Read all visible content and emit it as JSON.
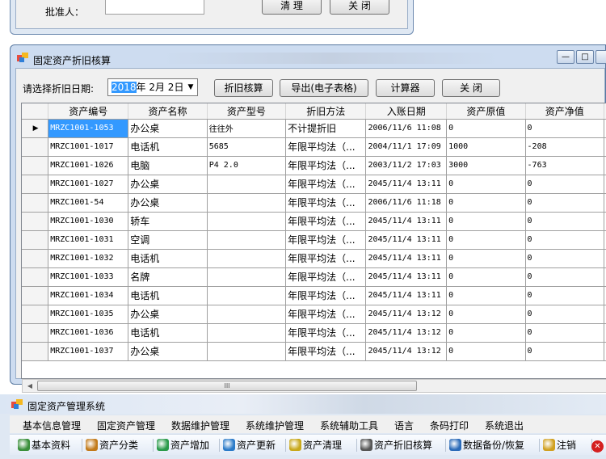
{
  "top_window": {
    "approver_label": "批准人：",
    "clear_button": "清 理",
    "close_button": "关 闭"
  },
  "dialog": {
    "title": "固定资产折旧核算",
    "date_label": "请选择折旧日期:",
    "date_value_year": "2018",
    "date_value_rest": "年 2月 2日",
    "buttons": {
      "calc": "折旧核算",
      "export": "导出(电子表格)",
      "calculator": "计算器",
      "close": "关 闭"
    },
    "columns": [
      "资产编号",
      "资产名称",
      "资产型号",
      "折旧方法",
      "入账日期",
      "资产原值",
      "资产净值"
    ],
    "rows": [
      [
        "MRZC1001-1053",
        "办公桌",
        "往往外",
        "不计提折旧",
        "2006/11/6 11:08",
        "0",
        "0"
      ],
      [
        "MRZC1001-1017",
        "电话机",
        "5685",
        "年限平均法（...",
        "2004/11/1 17:09",
        "1000",
        "-208"
      ],
      [
        "MRZC1001-1026",
        "电脑",
        "P4 2.0",
        "年限平均法（...",
        "2003/11/2 17:03",
        "3000",
        "-763"
      ],
      [
        "MRZC1001-1027",
        "办公桌",
        "",
        "年限平均法（...",
        "2045/11/4 13:11",
        "0",
        "0"
      ],
      [
        "MRZC1001-54",
        "办公桌",
        "",
        "年限平均法（...",
        "2006/11/6 11:18",
        "0",
        "0"
      ],
      [
        "MRZC1001-1030",
        "轿车",
        "",
        "年限平均法（...",
        "2045/11/4 13:11",
        "0",
        "0"
      ],
      [
        "MRZC1001-1031",
        "空调",
        "",
        "年限平均法（...",
        "2045/11/4 13:11",
        "0",
        "0"
      ],
      [
        "MRZC1001-1032",
        "电话机",
        "",
        "年限平均法（...",
        "2045/11/4 13:11",
        "0",
        "0"
      ],
      [
        "MRZC1001-1033",
        "名牌",
        "",
        "年限平均法（...",
        "2045/11/4 13:11",
        "0",
        "0"
      ],
      [
        "MRZC1001-1034",
        "电话机",
        "",
        "年限平均法（...",
        "2045/11/4 13:11",
        "0",
        "0"
      ],
      [
        "MRZC1001-1035",
        "办公桌",
        "",
        "年限平均法（...",
        "2045/11/4 13:12",
        "0",
        "0"
      ],
      [
        "MRZC1001-1036",
        "电话机",
        "",
        "年限平均法（...",
        "2045/11/4 13:12",
        "0",
        "0"
      ],
      [
        "MRZC1001-1037",
        "办公桌",
        "",
        "年限平均法（...",
        "2045/11/4 13:12",
        "0",
        "0"
      ]
    ],
    "scroll_grip": "III"
  },
  "app": {
    "title": "固定资产管理系统",
    "menu": [
      "基本信息管理",
      "固定资产管理",
      "数据维护管理",
      "系统维护管理",
      "系统辅助工具",
      "语言",
      "条码打印",
      "系统退出"
    ],
    "toolbar": [
      "基本资料",
      "资产分类",
      "资产增加",
      "资产更新",
      "资产清理",
      "资产折旧核算",
      "数据备份/恢复",
      "注销"
    ]
  },
  "colors": {
    "selection": "#3399ff",
    "title_bg": "#cddcf0",
    "toolbar_bg": "#e3ebf6"
  }
}
